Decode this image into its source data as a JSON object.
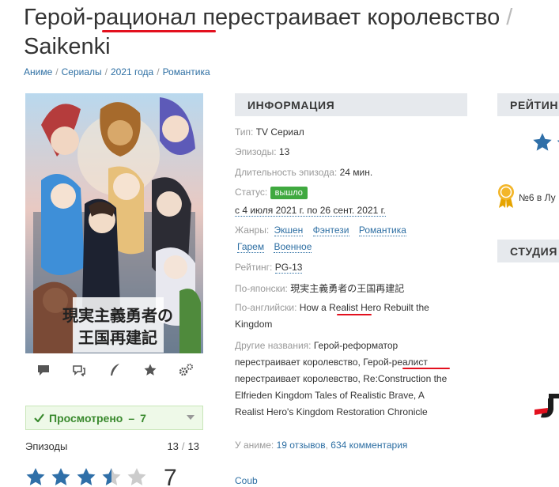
{
  "title": {
    "main": "Герой-рационал перестраивает королевство",
    "sep": "/",
    "sub": "Saikenki"
  },
  "breadcrumbs": [
    "Аниме",
    "Сериалы",
    "2021 года",
    "Романтика"
  ],
  "watched": {
    "label": "Просмотрено",
    "dash": "–",
    "count": "7"
  },
  "episodes_row": {
    "label": "Эпизоды",
    "watched": "13",
    "sep": "/",
    "total": "13"
  },
  "user_score": "7",
  "user_rating_fraction": 0.7,
  "info": {
    "heading": "ИНФОРМАЦИЯ",
    "type_label": "Тип:",
    "type_value": "TV Сериал",
    "episodes_label": "Эпизоды:",
    "episodes_value": "13",
    "duration_label": "Длительность эпизода:",
    "duration_value": "24 мин.",
    "status_label": "Статус:",
    "status_value": "вышло",
    "dates": "с 4 июля 2021 г. по 26 сент. 2021 г.",
    "genres_label": "Жанры:",
    "genres": [
      "Экшен",
      "Фэнтези",
      "Романтика",
      "Гарем",
      "Военное"
    ],
    "rating_label": "Рейтинг:",
    "rating_value": "PG-13",
    "jp_label": "По-японски:",
    "jp_value": "現実主義勇者の王国再建記",
    "en_label": "По-английски:",
    "en_value_1": "How a Realist Hero Rebuilt the",
    "en_value_2": "Kingdom",
    "other_label": "Другие названия:",
    "other_lines": [
      "Герой-реформатор",
      "перестраивает королевство, Герой-реалист",
      "перестраивает королевство, Re:Construction the",
      "Elfrieden Kingdom Tales of Realistic Brave, A",
      "Realist Hero's Kingdom Restoration Chronicle"
    ],
    "in_anime_label": "У аниме:",
    "reviews": "19 отзывов",
    "comments": "634 комментария",
    "coub": "Coub"
  },
  "right": {
    "rating_head": "РЕЙТИН",
    "rank": "№6 в Лу",
    "studio_head": "СТУДИЯ"
  },
  "colors": {
    "accent_red": "#e3101e",
    "link": "#2e6fa3",
    "star": "#2f6fa8",
    "status_green": "#3fa93f"
  }
}
